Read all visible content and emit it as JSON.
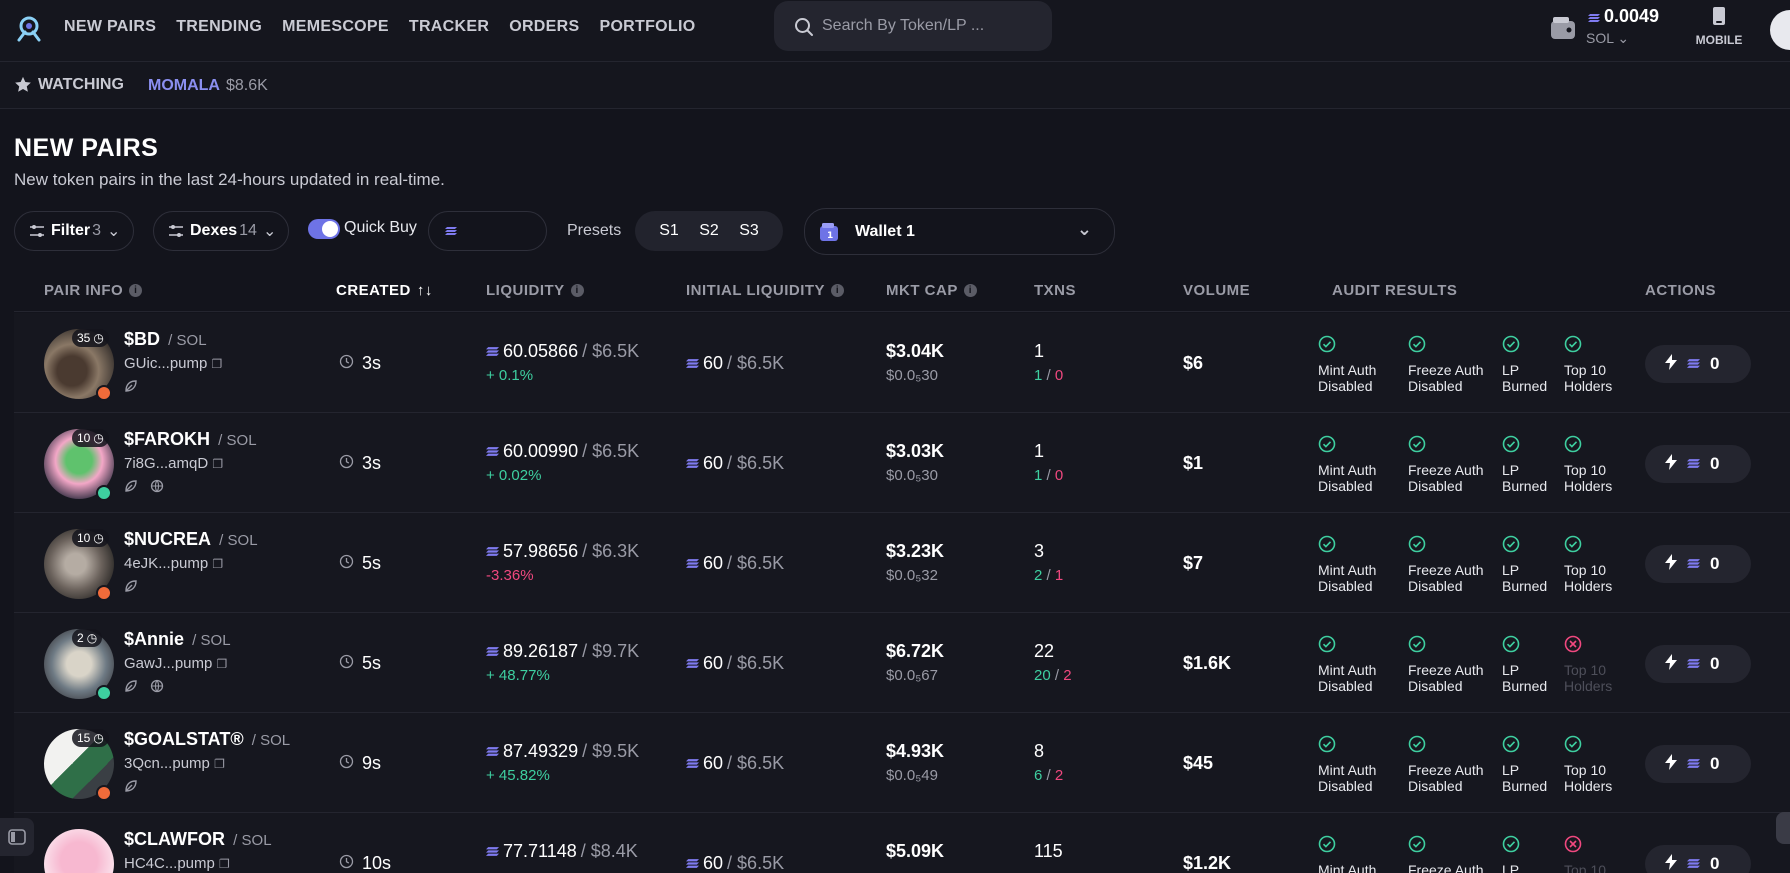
{
  "nav": {
    "links": [
      "NEW PAIRS",
      "TRENDING",
      "MEMESCOPE",
      "TRACKER",
      "ORDERS",
      "PORTFOLIO"
    ],
    "search_placeholder": "Search By Token/LP ...",
    "balance": "0.0049",
    "balance_unit": "SOL",
    "mobile_label": "MOBILE"
  },
  "watchbar": {
    "label": "WATCHING",
    "token": "MOMALA",
    "value": "$8.6K"
  },
  "page": {
    "title": "NEW PAIRS",
    "subtitle": "New token pairs in the last 24-hours updated in real-time."
  },
  "filters": {
    "filter_label": "Filter",
    "filter_count": "3",
    "dexes_label": "Dexes",
    "dexes_count": "14",
    "quick_buy_label": "Quick Buy",
    "quick_buy_on": true,
    "presets_label": "Presets",
    "presets": [
      "S1",
      "S2",
      "S3"
    ],
    "wallet_label": "Wallet 1",
    "wallet_number": "1"
  },
  "columns": {
    "pair_info": "PAIR INFO",
    "created": "CREATED",
    "liquidity": "LIQUIDITY",
    "initial_liquidity": "INITIAL LIQUIDITY",
    "mkt_cap": "MKT CAP",
    "txns": "TXNS",
    "volume": "VOLUME",
    "audit_results": "AUDIT RESULTS",
    "actions": "ACTIONS"
  },
  "rows": [
    {
      "symbol": "$BD",
      "chain": "SOL",
      "addr": "GUic...pump",
      "badge": "35",
      "created": "3s",
      "liq": "60.05866",
      "liq_usd": "$6.5K",
      "chg": "+ 0.1%",
      "chg_pos": true,
      "iliq": "60",
      "iliq_usd": "$6.5K",
      "mc": "$3.04K",
      "price": "$0.0₅30",
      "tx": "1",
      "buys": "1",
      "sells": "0",
      "vol": "$6",
      "mint": "Mint Auth Disabled",
      "freeze": "Freeze Auth Disabled",
      "lp": "LP Burned",
      "top10": "Top 10 Holders",
      "top10_ok": true,
      "action": "0"
    },
    {
      "symbol": "$FAROKH",
      "chain": "SOL",
      "addr": "7i8G...amqD",
      "badge": "10",
      "created": "3s",
      "liq": "60.00990",
      "liq_usd": "$6.5K",
      "chg": "+ 0.02%",
      "chg_pos": true,
      "iliq": "60",
      "iliq_usd": "$6.5K",
      "mc": "$3.03K",
      "price": "$0.0₅30",
      "tx": "1",
      "buys": "1",
      "sells": "0",
      "vol": "$1",
      "mint": "Mint Auth Disabled",
      "freeze": "Freeze Auth Disabled",
      "lp": "LP Burned",
      "top10": "Top 10 Holders",
      "top10_ok": true,
      "action": "0"
    },
    {
      "symbol": "$NUCREA",
      "chain": "SOL",
      "addr": "4eJK...pump",
      "badge": "10",
      "created": "5s",
      "liq": "57.98656",
      "liq_usd": "$6.3K",
      "chg": "-3.36%",
      "chg_pos": false,
      "iliq": "60",
      "iliq_usd": "$6.5K",
      "mc": "$3.23K",
      "price": "$0.0₅32",
      "tx": "3",
      "buys": "2",
      "sells": "1",
      "vol": "$7",
      "mint": "Mint Auth Disabled",
      "freeze": "Freeze Auth Disabled",
      "lp": "LP Burned",
      "top10": "Top 10 Holders",
      "top10_ok": true,
      "action": "0"
    },
    {
      "symbol": "$Annie",
      "chain": "SOL",
      "addr": "GawJ...pump",
      "badge": "2",
      "created": "5s",
      "liq": "89.26187",
      "liq_usd": "$9.7K",
      "chg": "+ 48.77%",
      "chg_pos": true,
      "iliq": "60",
      "iliq_usd": "$6.5K",
      "mc": "$6.72K",
      "price": "$0.0₅67",
      "tx": "22",
      "buys": "20",
      "sells": "2",
      "vol": "$1.6K",
      "mint": "Mint Auth Disabled",
      "freeze": "Freeze Auth Disabled",
      "lp": "LP Burned",
      "top10": "Top 10 Holders",
      "top10_ok": false,
      "action": "0"
    },
    {
      "symbol": "$GOALSTAT®",
      "chain": "SOL",
      "addr": "3Qcn...pump",
      "badge": "15",
      "created": "9s",
      "liq": "87.49329",
      "liq_usd": "$9.5K",
      "chg": "+ 45.82%",
      "chg_pos": true,
      "iliq": "60",
      "iliq_usd": "$6.5K",
      "mc": "$4.93K",
      "price": "$0.0₅49",
      "tx": "8",
      "buys": "6",
      "sells": "2",
      "vol": "$45",
      "mint": "Mint Auth Disabled",
      "freeze": "Freeze Auth Disabled",
      "lp": "LP Burned",
      "top10": "Top 10 Holders",
      "top10_ok": true,
      "action": "0"
    },
    {
      "symbol": "$CLAWFOR",
      "chain": "SOL",
      "addr": "HC4C...pump",
      "badge": "",
      "created": "10s",
      "liq": "77.71148",
      "liq_usd": "$8.4K",
      "chg": "",
      "chg_pos": true,
      "iliq": "60",
      "iliq_usd": "$6.5K",
      "mc": "$5.09K",
      "price": "",
      "tx": "115",
      "buys": "",
      "sells": "",
      "vol": "$1.2K",
      "mint": "Mint Auth",
      "freeze": "Freeze Auth",
      "lp": "LP",
      "top10": "Top 10",
      "top10_ok": false,
      "action": "0"
    }
  ],
  "colors": {
    "accent": "#8b8ff0",
    "green": "#3ecfa0",
    "red": "#f0487f",
    "bg": "#13141c"
  }
}
